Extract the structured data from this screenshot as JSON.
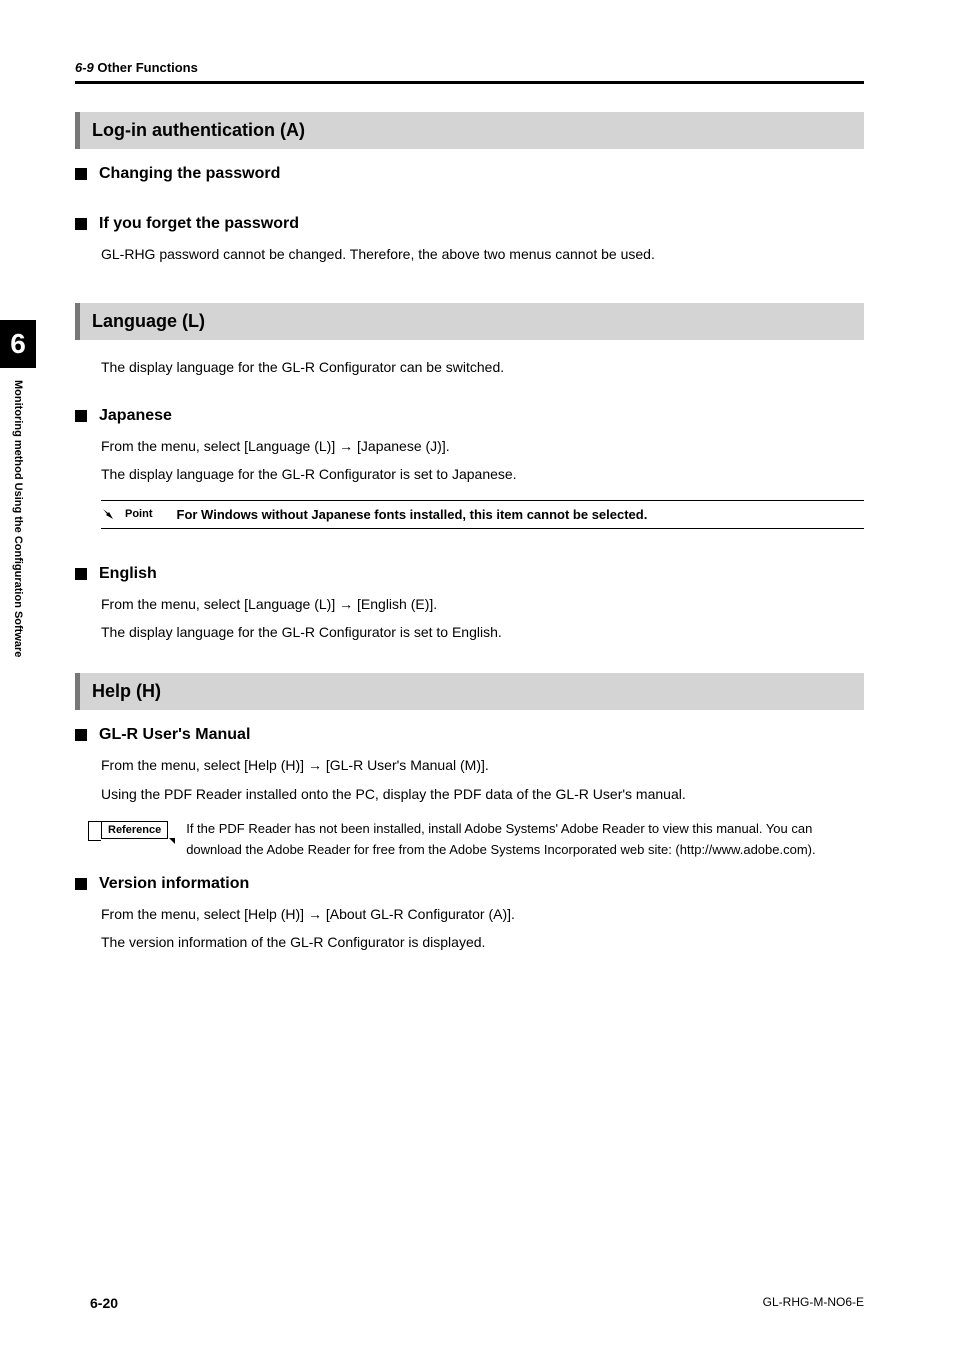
{
  "header": {
    "section": "6-9",
    "title": "Other Functions"
  },
  "chapter": {
    "number": "6",
    "label": "Monitoring method Using the Configuration Software"
  },
  "sections": [
    {
      "heading": "Log-in authentication (A)",
      "subs": [
        {
          "title": "Changing the password",
          "paras": []
        },
        {
          "title": "If you forget the password",
          "paras": [
            "GL-RHG password cannot be changed. Therefore, the above two menus cannot be used."
          ]
        }
      ]
    },
    {
      "heading": "Language (L)",
      "intro": "The display language for the GL-R Configurator can be switched.",
      "subs": [
        {
          "title": "Japanese",
          "paras": [
            "From the menu, select [Language (L)] → [Japanese (J)].",
            "The display language for the GL-R Configurator is set to Japanese."
          ],
          "point": {
            "label": "Point",
            "text": "For Windows without Japanese fonts installed, this item cannot be selected."
          }
        },
        {
          "title": "English",
          "paras": [
            "From the menu, select [Language (L)] → [English (E)].",
            "The display language for the GL-R Configurator is set to English."
          ]
        }
      ]
    },
    {
      "heading": "Help (H)",
      "subs": [
        {
          "title": "GL-R User's Manual",
          "paras": [
            "From the menu, select [Help (H)] → [GL-R User's Manual (M)].",
            "Using the PDF Reader installed onto the PC, display the PDF data of the GL-R User's manual."
          ],
          "reference": {
            "label": "Reference",
            "text": "If the PDF Reader has not been installed, install Adobe Systems' Adobe Reader to view this manual. You can download the Adobe Reader for free from the Adobe Systems Incorporated web site: (http://www.adobe.com)."
          }
        },
        {
          "title": "Version information",
          "paras": [
            "From the menu, select [Help (H)] → [About GL-R Configurator (A)].",
            "The version information of the GL-R Configurator is displayed."
          ]
        }
      ]
    }
  ],
  "footer": {
    "page": "6-20",
    "doc": "GL-RHG-M-NO6-E"
  }
}
